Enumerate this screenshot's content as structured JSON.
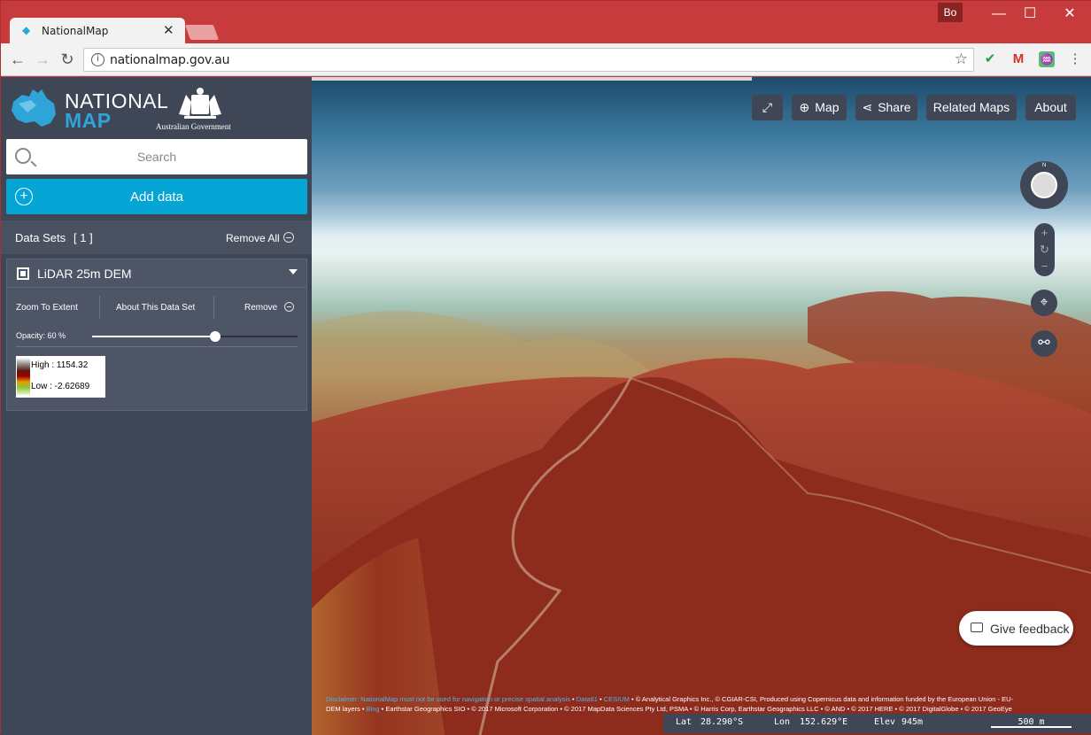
{
  "browser": {
    "tab_title": "NationalMap",
    "profile": "Bo",
    "url": "nationalmap.gov.au"
  },
  "sidebar": {
    "logo_line1": "NATIONAL",
    "logo_line2": "MAP",
    "gov_label": "Australian Government",
    "search_placeholder": "Search",
    "add_data_label": "Add data",
    "datasets_label": "Data Sets",
    "datasets_count": "[ 1 ]",
    "remove_all_label": "Remove All",
    "dataset": {
      "name": "LiDAR 25m DEM",
      "zoom_to_extent": "Zoom To Extent",
      "about": "About This Data Set",
      "remove": "Remove",
      "opacity_label": "Opacity: 60 %",
      "opacity": 0.6,
      "legend_high": "High : 1154.32",
      "legend_low": "Low : -2.62689"
    }
  },
  "map": {
    "buttons": {
      "map": "Map",
      "share": "Share",
      "related": "Related Maps",
      "about": "About"
    },
    "compass_n": "N",
    "feedback": "Give feedback",
    "disclaimer_prefix": "Disclaimer: NationalMap must not be used for navigation or precise spatial analysis",
    "attr_data61": "Data61",
    "attr_cesium": "CESIUM",
    "attr_line1_rest": "© Analytical Graphics Inc., © CGIAR-CSI, Produced using Copernicus data and information funded by the European Union - EU-",
    "attr_line2_start": "DEM layers",
    "attr_bing": "Bing",
    "attr_line2_rest": "Earthstar Geographics SIO • © 2017 Microsoft Corporation • © 2017 MapData Sciences Pty Ltd, PSMA • © Harris Corp, Earthstar Geographics LLC • © AND • © 2017 HERE • © 2017 DigitalGlobe • © 2017 GeoEye",
    "lat_label": "Lat",
    "lat_value": "28.290°S",
    "lon_label": "Lon",
    "lon_value": "152.629°E",
    "elev_label": "Elev",
    "elev_value": "945m",
    "scale_label": "500 m"
  }
}
